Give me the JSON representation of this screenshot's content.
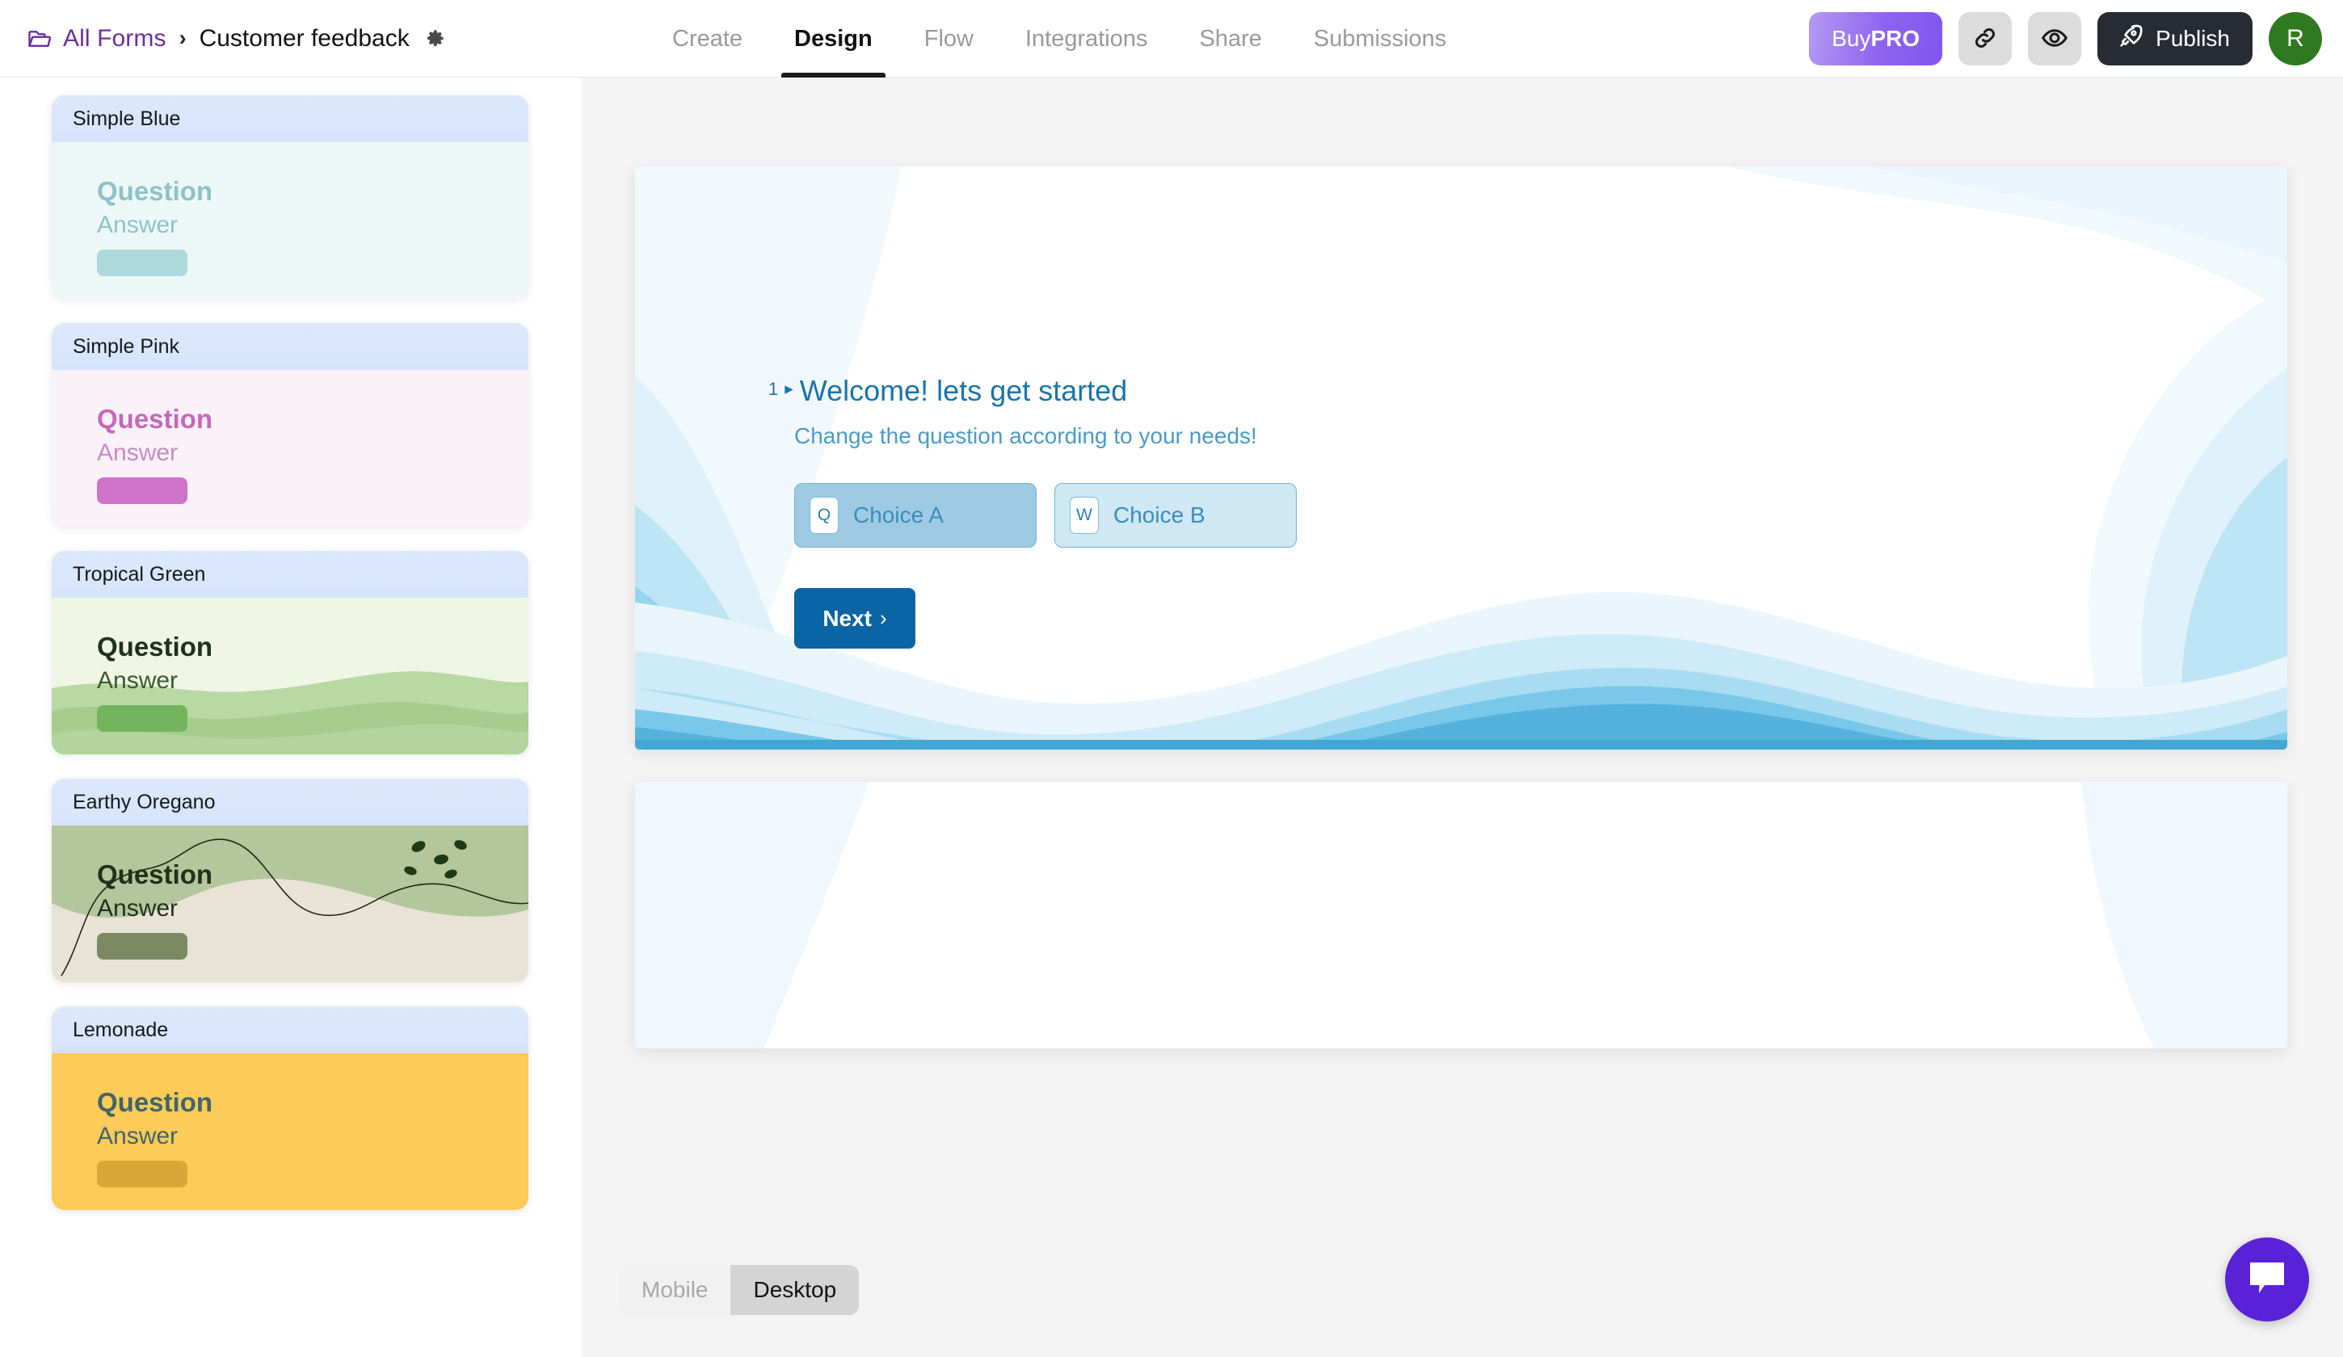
{
  "header": {
    "breadcrumb": {
      "folder_icon": "folder-icon",
      "root_label": "All Forms",
      "separator": "›",
      "form_title": "Customer feedback",
      "settings_icon": "gear-icon"
    },
    "tabs": [
      {
        "label": "Create",
        "active": false
      },
      {
        "label": "Design",
        "active": true
      },
      {
        "label": "Flow",
        "active": false
      },
      {
        "label": "Integrations",
        "active": false
      },
      {
        "label": "Share",
        "active": false
      },
      {
        "label": "Submissions",
        "active": false
      }
    ],
    "actions": {
      "buy_prefix": "Buy",
      "buy_strong": "PRO",
      "link_icon": "link-icon",
      "preview_icon": "eye-icon",
      "publish_label": "Publish",
      "publish_icon": "rocket-icon",
      "avatar_initial": "R"
    },
    "colors": {
      "brand_purple": "#6b2fa0",
      "pro_gradient_from": "#b59af3",
      "pro_gradient_to": "#8055ee",
      "publish_bg": "#272b33",
      "avatar_bg": "#2f7a20",
      "active_tab": "#101010"
    }
  },
  "sidebar": {
    "themes": [
      {
        "name": "Simple Blue",
        "question_label": "Question",
        "answer_label": "Answer",
        "bg": "#edf8f6",
        "question_color": "#8cc3c8",
        "answer_color": "#8cc3c8",
        "pill_color": "#aed9dd",
        "style": "plain"
      },
      {
        "name": "Simple Pink",
        "question_label": "Question",
        "answer_label": "Answer",
        "bg": "#faf2f8",
        "question_color": "#c667bf",
        "answer_color": "#c98bc4",
        "pill_color": "#cf72c9",
        "style": "plain"
      },
      {
        "name": "Tropical Green",
        "question_label": "Question",
        "answer_label": "Answer",
        "bg": "#edf5e2",
        "question_color": "#20321b",
        "answer_color": "#3a5a32",
        "pill_color": "#74b45e",
        "style": "hills"
      },
      {
        "name": "Earthy Oregano",
        "question_label": "Question",
        "answer_label": "Answer",
        "bg": "#e8e2d6",
        "question_color": "#22301c",
        "answer_color": "#22301c",
        "pill_color": "#7b8a62",
        "style": "botanical"
      },
      {
        "name": "Lemonade",
        "question_label": "Question",
        "answer_label": "Answer",
        "bg": "#fccb58",
        "question_color": "#42656b",
        "answer_color": "#42656b",
        "pill_color": "#d9a63a",
        "style": "plain"
      }
    ]
  },
  "preview": {
    "slide": {
      "question_number": "1",
      "caret": "▸",
      "title": "Welcome! lets get started",
      "subtitle": "Change the question according to your needs!",
      "choices": [
        {
          "key": "Q",
          "label": "Choice A",
          "selected": true
        },
        {
          "key": "W",
          "label": "Choice B",
          "selected": false
        }
      ],
      "next_label": "Next",
      "next_chevron": "›"
    },
    "theme_colors": {
      "title": "#1a74ab",
      "subtitle": "#4a9bc9",
      "choice_selected_bg": "#9ecbe3",
      "choice_bg": "#cfe8f3",
      "choice_border": "#6fb3d6",
      "next_bg": "#0b64a3",
      "wave_layers": [
        "#f2f9fd",
        "#dff1fb",
        "#bde4f5",
        "#98d4ef",
        "#6cc2e8",
        "#4badd9",
        "#3a9fcd"
      ]
    }
  },
  "footer": {
    "view_toggle": [
      {
        "label": "Mobile",
        "active": false
      },
      {
        "label": "Desktop",
        "active": true
      }
    ]
  },
  "widgets": {
    "chat": {
      "icon": "chat-bubble-icon",
      "color": "#5a22d6"
    }
  }
}
